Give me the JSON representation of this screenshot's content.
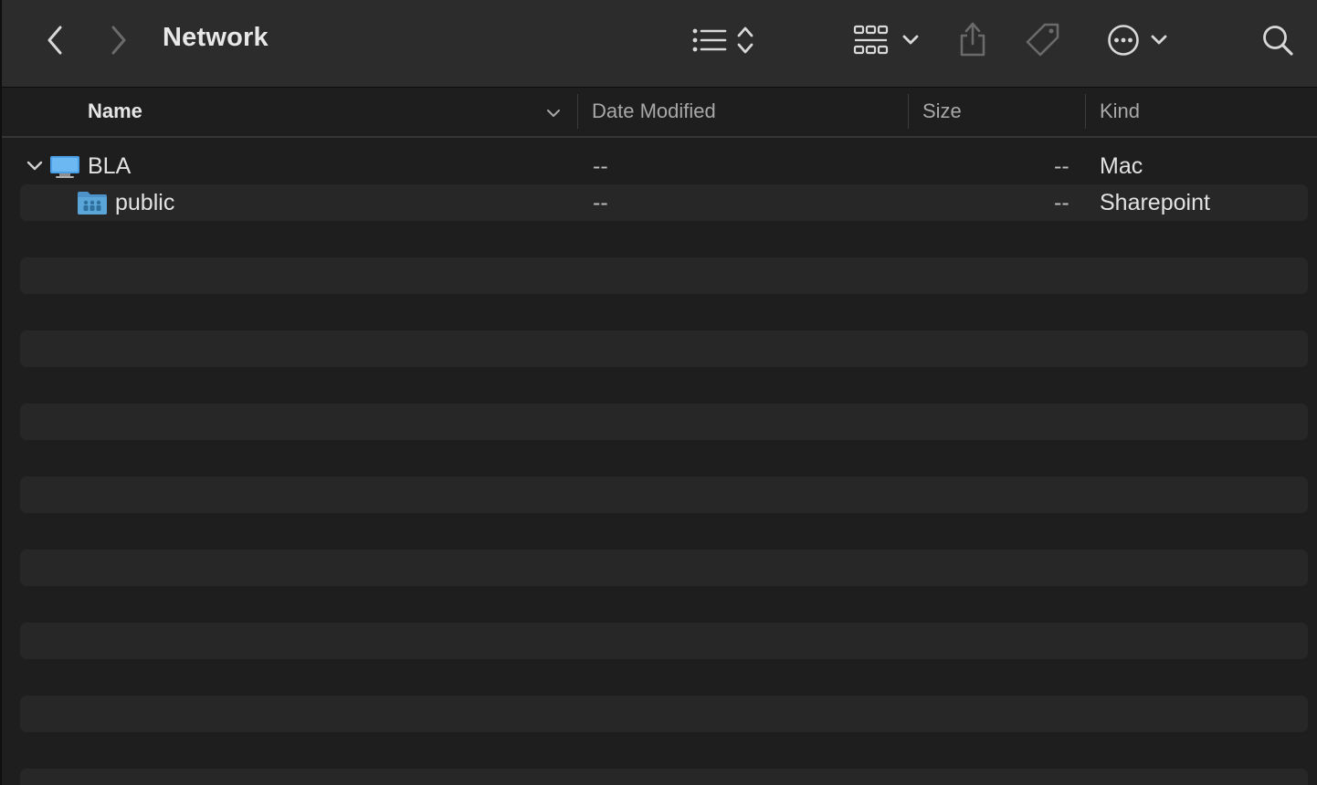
{
  "window": {
    "title": "Network"
  },
  "toolbar": {
    "icons": [
      "chevron-left-icon",
      "chevron-right-icon",
      "list-view-icon",
      "sort-arrows-icon",
      "grid-view-icon",
      "chevron-down-icon",
      "share-icon",
      "tag-icon",
      "ellipsis-circle-icon",
      "search-icon"
    ]
  },
  "columns": {
    "name": "Name",
    "date_modified": "Date Modified",
    "size": "Size",
    "kind": "Kind"
  },
  "rows": [
    {
      "name": "BLA",
      "date_modified": "--",
      "size": "--",
      "kind": "Mac",
      "icon": "computer-icon",
      "expanded": true
    },
    {
      "name": "public",
      "date_modified": "--",
      "size": "--",
      "kind": "Sharepoint",
      "icon": "shared-folder-icon"
    }
  ],
  "colors": {
    "toolbar_bg": "#2c2c2c",
    "content_bg": "#1e1e1e",
    "stripe_bg": "#272727",
    "folder_blue": "#5aa6d8"
  }
}
